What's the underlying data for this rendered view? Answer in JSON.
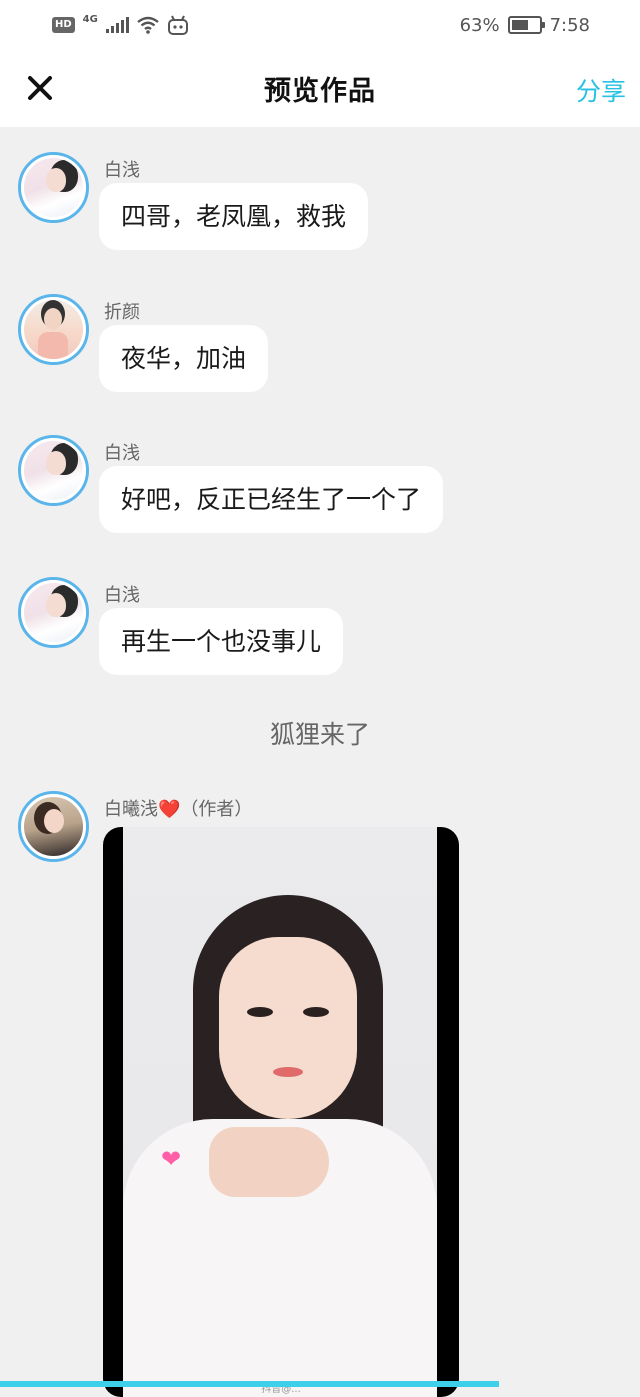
{
  "status_bar": {
    "hd": "HD",
    "network": "4G",
    "battery": "63%",
    "time": "7:58"
  },
  "nav": {
    "title": "预览作品",
    "share": "分享"
  },
  "messages": [
    {
      "name": "白浅",
      "text": "四哥，老凤凰，救我"
    },
    {
      "name": "折颜",
      "text": "夜华，加油"
    },
    {
      "name": "白浅",
      "text": "好吧，反正已经生了一个了"
    },
    {
      "name": "白浅",
      "text": "再生一个也没事儿"
    }
  ],
  "narration": "狐狸来了",
  "author": {
    "name": "白曦浅",
    "heart": "❤️",
    "tag": "（作者）"
  },
  "video": {
    "caption": "抖音@..."
  },
  "accent_color": "#27c1e3",
  "progress": 0.78
}
